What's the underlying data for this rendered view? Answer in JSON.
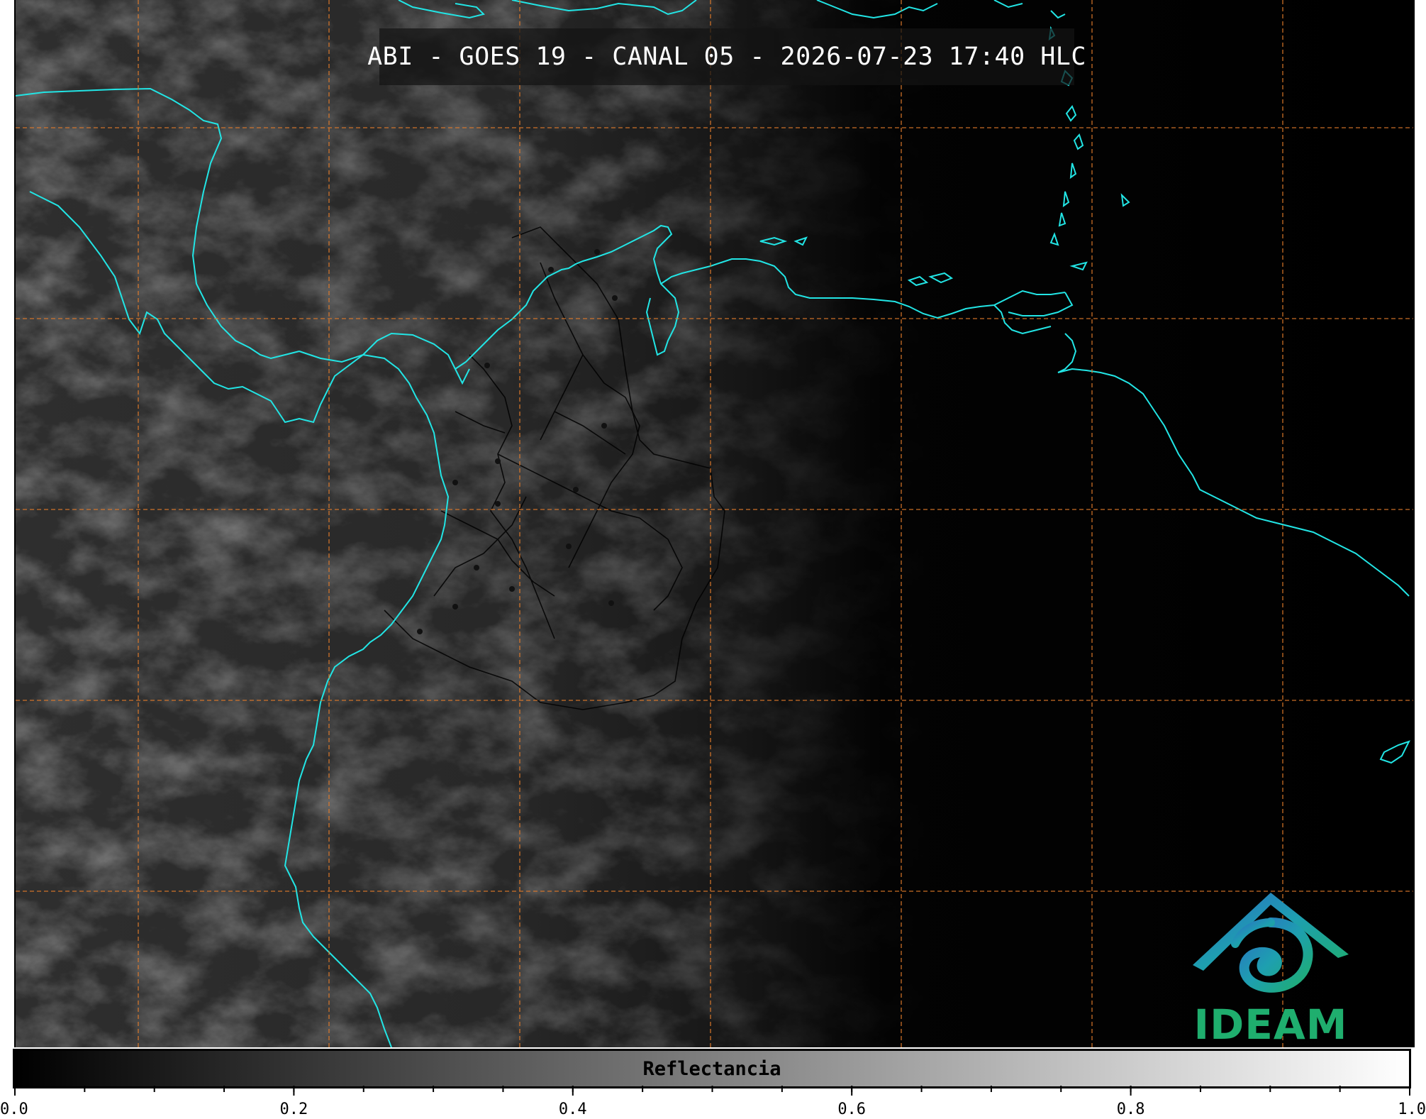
{
  "title": "ABI - GOES 19 - CANAL 05 - 2026-07-23 17:40 HLC",
  "colorbar": {
    "label": "Reflectancia",
    "min": 0.0,
    "max": 1.0,
    "major_ticks": [
      0.0,
      0.2,
      0.4,
      0.6,
      0.8,
      1.0
    ],
    "major_tick_labels": [
      "0.0",
      "0.2",
      "0.4",
      "0.6",
      "0.8",
      "1.0"
    ],
    "minor_tick_step": 0.05,
    "colormap": [
      "#000000",
      "#ffffff"
    ]
  },
  "map": {
    "grid_color": "#e07a2a",
    "coastline_color": "#22e5e5",
    "border_color": "#000000",
    "grid_style": "dashed",
    "night_side": "east"
  },
  "logo": {
    "text": "IDEAM",
    "text_color": "#1fae6e",
    "icon": "ideam-logo-icon"
  }
}
